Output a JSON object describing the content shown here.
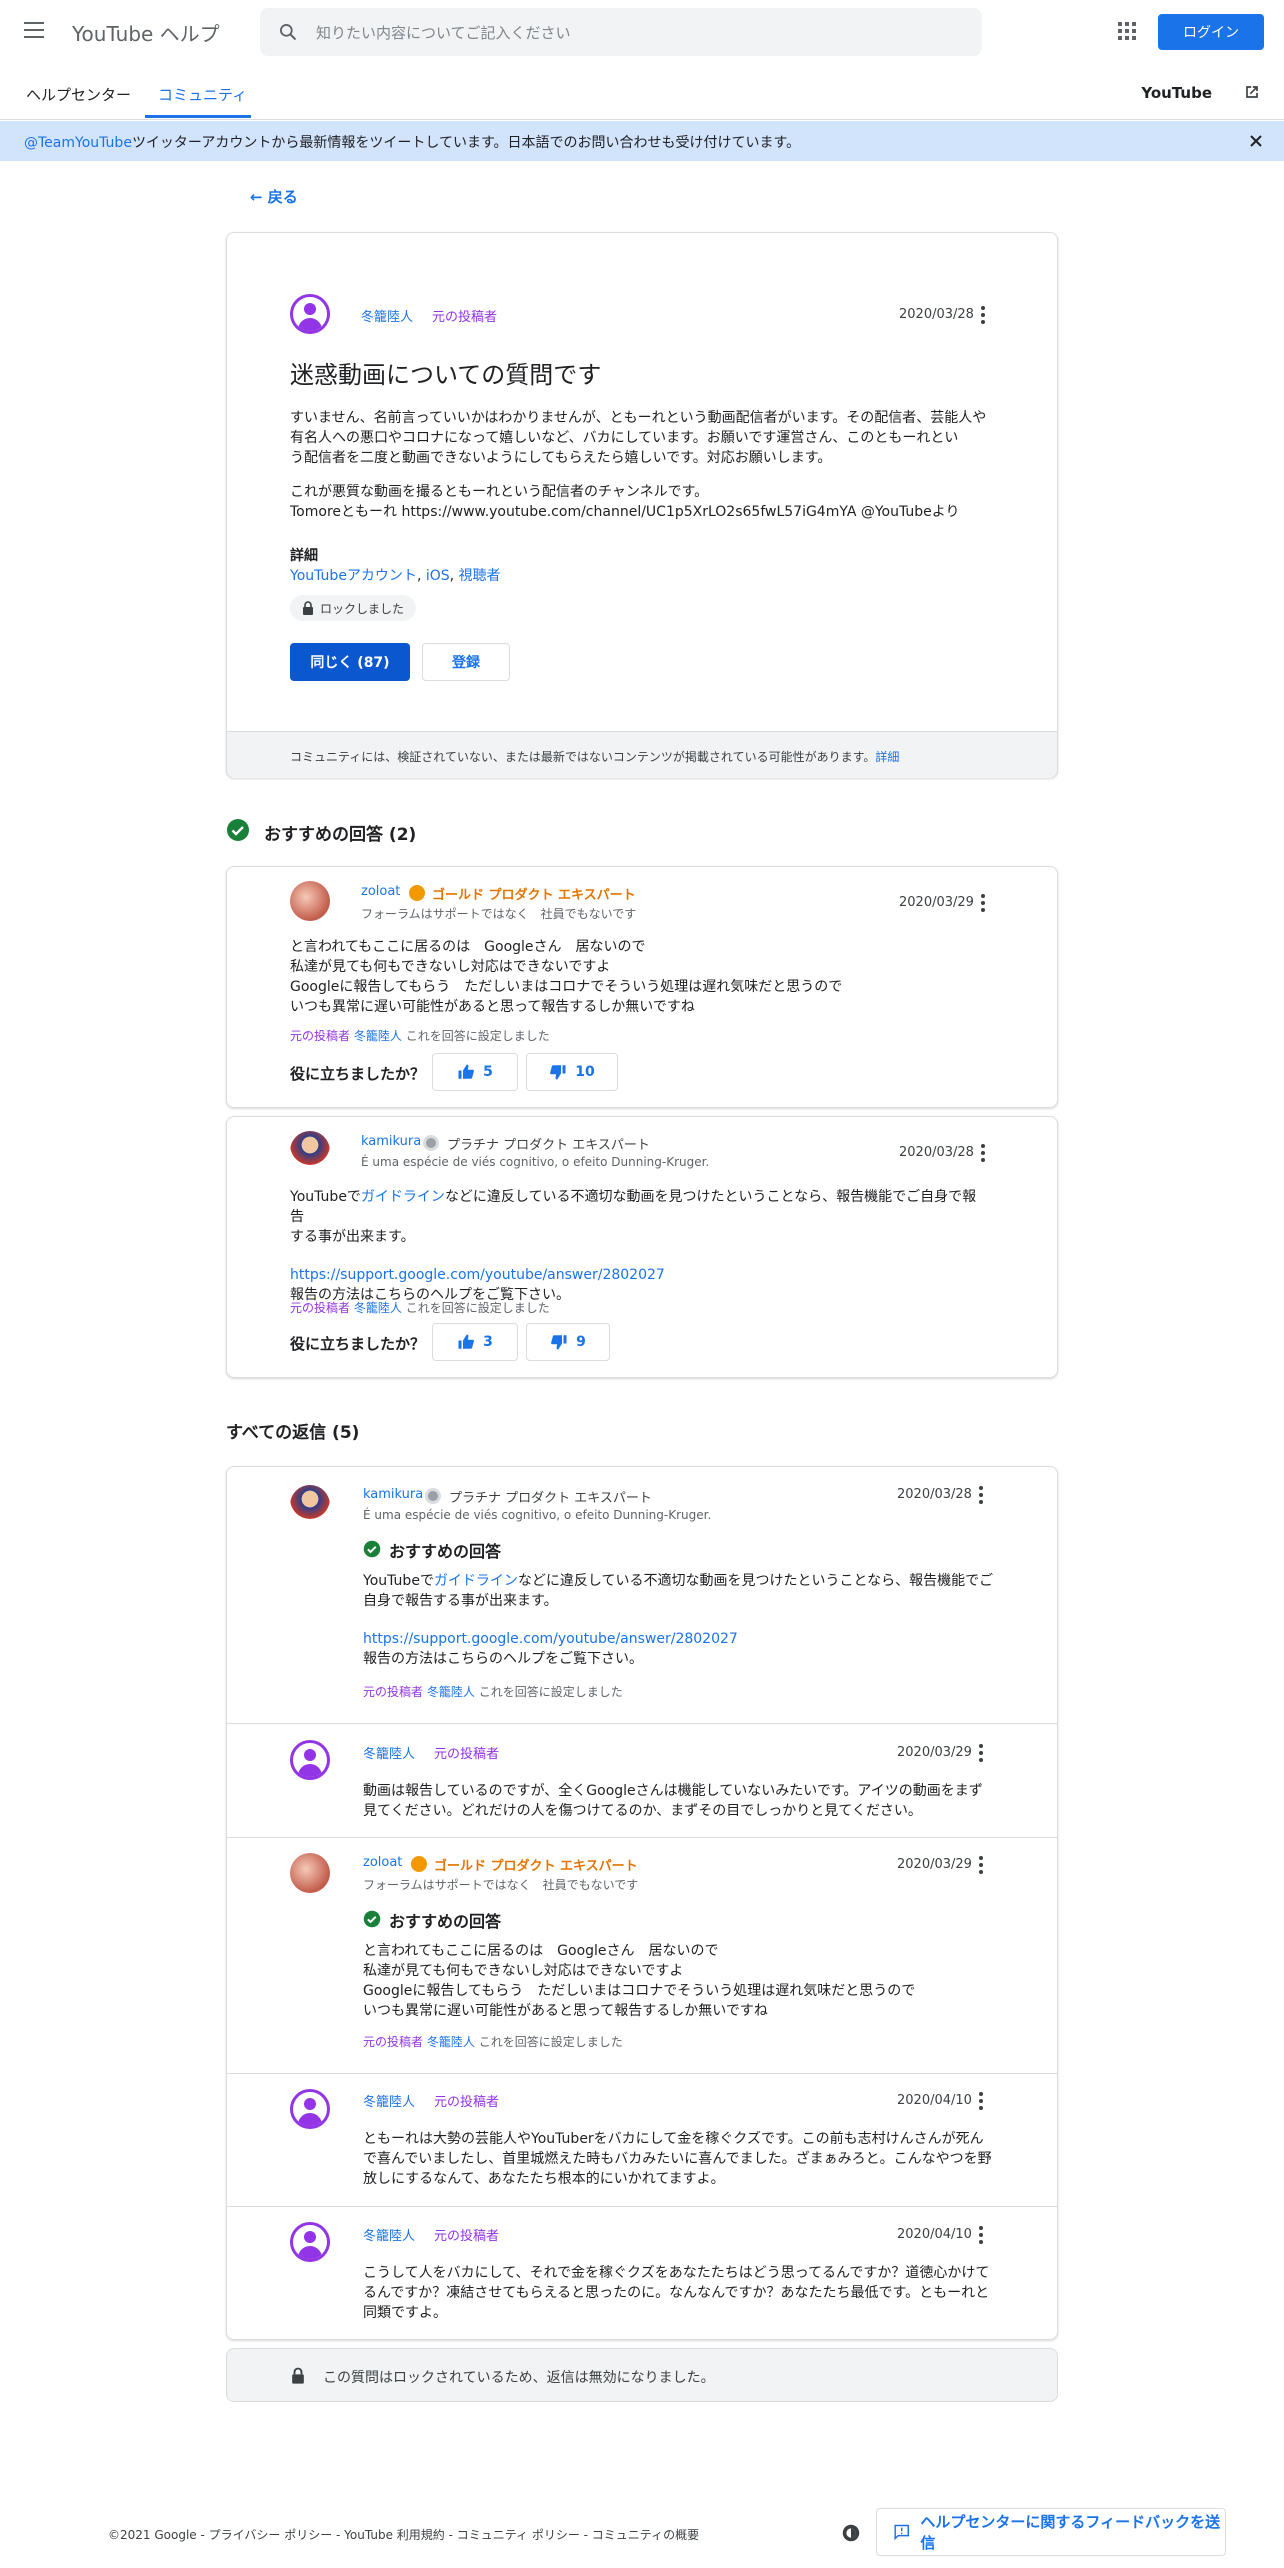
{
  "header": {
    "brand": "YouTube ヘルプ",
    "search_placeholder": "知りたい内容についてご記入ください",
    "login_label": "ログイン"
  },
  "nav": {
    "tabs": [
      "ヘルプセンター",
      "コミュニティ"
    ],
    "youtube_link": "YouTube"
  },
  "banner": {
    "handle": "@TeamYouTube",
    "text": "ツイッターアカウントから最新情報をツイートしています。日本語でのお問い合わせも受け付けています。"
  },
  "back_label": "戻る",
  "question": {
    "author": "冬籠陸人",
    "op_label": "元の投稿者",
    "date": "2020/03/28",
    "title": "迷惑動画についての質問です",
    "body_lines": [
      "すいません、名前言っていいかはわかりませんが、ともーれという動画配信者がいます。その配信者、芸能人や",
      "有名人への悪口やコロナになって嬉しいなど、バカにしています。お願いです運営さん、このともーれとい",
      "う配信者を二度と動画できないようにしてもらえたら嬉しいです。対応お願いします。"
    ],
    "body2_lines": [
      "これが悪質な動画を撮るともーれという配信者のチャンネルです。",
      "Tomoreともーれ https://www.youtube.com/channel/UC1p5XrLO2s65fwL57iG4mYA @YouTubeより"
    ],
    "details_label": "詳細",
    "detail_links": [
      "YouTubeアカウント",
      "iOS",
      "視聴者"
    ],
    "locked_label": "ロックしました",
    "same_button": "同じく (87)",
    "subscribe_button": "登録",
    "disclaimer": "コミュニティには、検証されていない、または最新ではないコンテンツが掲載されている可能性があります。",
    "disclaimer_link": "詳細"
  },
  "recommended": {
    "title": "おすすめの回答 (2)",
    "answers": [
      {
        "author": "zoloat",
        "expert": "ゴールド プロダクト エキスパート",
        "sub": "フォーラムはサポートではなく　社員でもないです",
        "date": "2020/03/29",
        "lines": [
          "と言われてもここに居るのは　Googleさん　居ないので",
          "私達が見ても何もできないし対応はできないですよ",
          "Googleに報告してもらう　ただしいまはコロナでそういう処理は遅れ気味だと思うので",
          "いつも異常に遅い可能性があると思って報告するしか無いですね"
        ],
        "note_op": "元の投稿者",
        "note_name": "冬籠陸人",
        "note_rest": "これを回答に設定しました",
        "helpful": "役に立ちましたか？",
        "up": "5",
        "down": "10"
      },
      {
        "author": "kamikura",
        "expert": "プラチナ プロダクト エキスパート",
        "sub": "É uma espécie de viés cognitivo, o efeito Dunning-Kruger.",
        "date": "2020/03/28",
        "line1_pre": "YouTubeで",
        "line1_link": "ガイドライン",
        "line1_post": "などに違反している不適切な動画を見つけたということなら、報告機能でご自身で報告",
        "line2": "する事が出来ます。",
        "url": "https://support.google.com/youtube/answer/2802027",
        "line3": "報告の方法はこちらのヘルプをご覧下さい。",
        "note_op": "元の投稿者",
        "note_name": "冬籠陸人",
        "note_rest": "これを回答に設定しました",
        "helpful": "役に立ちましたか？",
        "up": "3",
        "down": "9"
      }
    ]
  },
  "all_replies": {
    "title": "すべての返信 (5)",
    "rec_label": "おすすめの回答",
    "replies": [
      {
        "author": "kamikura",
        "expert": "プラチナ プロダクト エキスパート",
        "sub": "É uma espécie de viés cognitivo, o efeito Dunning-Kruger.",
        "date": "2020/03/28",
        "line1_pre": "YouTubeで",
        "line1_link": "ガイドライン",
        "line1_post": "などに違反している不適切な動画を見つけたということなら、報告機能でご",
        "line2": "自身で報告する事が出来ます。",
        "url": "https://support.google.com/youtube/answer/2802027",
        "line3": "報告の方法はこちらのヘルプをご覧下さい。",
        "note_op": "元の投稿者",
        "note_name": "冬籠陸人",
        "note_rest": "これを回答に設定しました"
      },
      {
        "author": "冬籠陸人",
        "op": "元の投稿者",
        "date": "2020/03/29",
        "lines": [
          "動画は報告しているのですが、全くGoogleさんは機能していないみたいです。アイツの動画をまず",
          "見てください。どれだけの人を傷つけてるのか、まずその目でしっかりと見てください。"
        ]
      },
      {
        "author": "zoloat",
        "expert": "ゴールド プロダクト エキスパート",
        "sub": "フォーラムはサポートではなく　社員でもないです",
        "date": "2020/03/29",
        "lines": [
          "と言われてもここに居るのは　Googleさん　居ないので",
          "私達が見ても何もできないし対応はできないですよ",
          "Googleに報告してもらう　ただしいまはコロナでそういう処理は遅れ気味だと思うので",
          "いつも異常に遅い可能性があると思って報告するしか無いですね"
        ],
        "note_op": "元の投稿者",
        "note_name": "冬籠陸人",
        "note_rest": "これを回答に設定しました"
      },
      {
        "author": "冬籠陸人",
        "op": "元の投稿者",
        "date": "2020/04/10",
        "lines": [
          "ともーれは大勢の芸能人やYouTuberをバカにして金を稼ぐクズです。この前も志村けんさんが死ん",
          "で喜んでいましたし、首里城燃えた時もバカみたいに喜んでました。ざまぁみろと。こんなやつを野",
          "放しにするなんて、あなたたち根本的にいかれてますよ。"
        ]
      },
      {
        "author": "冬籠陸人",
        "op": "元の投稿者",
        "date": "2020/04/10",
        "lines": [
          "こうして人をバカにして、それで金を稼ぐクズをあなたたちはどう思ってるんですか？道徳心かけて",
          "るんですか？凍結させてもらえると思ったのに。なんなんですか？あなたたち最低です。ともーれと",
          "同類ですよ。"
        ]
      }
    ],
    "locked_notice": "この質問はロックされているため、返信は無効になりました。"
  },
  "footer": {
    "links": "©2021 Google - プライバシー ポリシー - YouTube 利用規約 - コミュニティ ポリシー - コミュニティの概要",
    "feedback": "ヘルプセンターに関するフィードバックを送信"
  },
  "colors": {
    "accent": "#1a73e8",
    "op": "#9334e6",
    "gold": "#e37400",
    "banner": "#d2e3fc"
  }
}
